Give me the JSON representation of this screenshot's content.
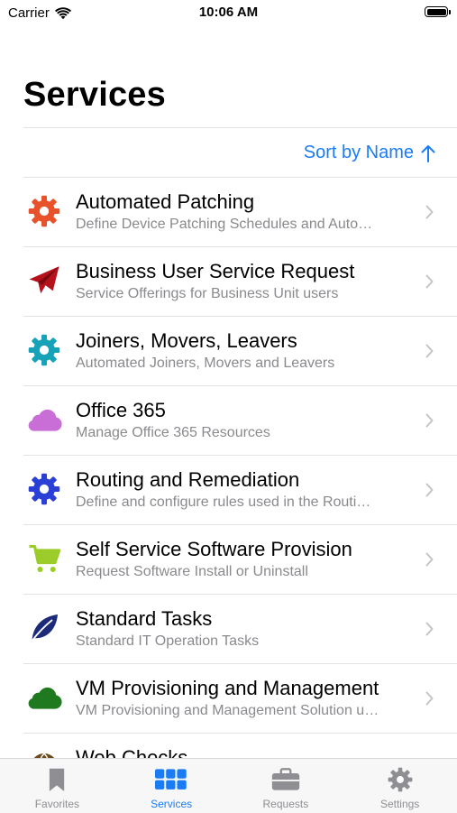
{
  "status_bar": {
    "carrier": "Carrier",
    "time": "10:06 AM"
  },
  "page_title": "Services",
  "sort": {
    "label": "Sort by Name",
    "accent": "#1a7cf5"
  },
  "services": [
    {
      "title": "Automated Patching",
      "subtitle": "Define Device Patching Schedules and Auto…",
      "icon": "gear-icon",
      "color": "#e8522a"
    },
    {
      "title": "Business User Service Request",
      "subtitle": "Service Offerings for Business Unit users",
      "icon": "paper-plane-icon",
      "color": "#b5121b"
    },
    {
      "title": "Joiners, Movers, Leavers",
      "subtitle": "Automated Joiners, Movers and Leavers",
      "icon": "gear-icon",
      "color": "#16a2b8"
    },
    {
      "title": "Office 365",
      "subtitle": "Manage Office 365 Resources",
      "icon": "cloud-icon",
      "color": "#c86ed6"
    },
    {
      "title": "Routing and Remediation",
      "subtitle": "Define and configure rules used in the Routi…",
      "icon": "gear-icon",
      "color": "#2a3fd6"
    },
    {
      "title": "Self Service Software Provision",
      "subtitle": "Request Software Install or Uninstall",
      "icon": "cart-icon",
      "color": "#9ccc2a"
    },
    {
      "title": "Standard Tasks",
      "subtitle": "Standard IT Operation Tasks",
      "icon": "leaf-icon",
      "color": "#1c2a7a"
    },
    {
      "title": "VM Provisioning and Management",
      "subtitle": "VM Provisioning and Management Solution u…",
      "icon": "cloud-icon",
      "color": "#1f7a1f"
    },
    {
      "title": "Web Checks",
      "subtitle": "",
      "icon": "globe-icon",
      "color": "#6b4a1e"
    }
  ],
  "tabs": [
    {
      "label": "Favorites",
      "icon": "bookmark-icon",
      "active": false
    },
    {
      "label": "Services",
      "icon": "grid-icon",
      "active": true
    },
    {
      "label": "Requests",
      "icon": "briefcase-icon",
      "active": false
    },
    {
      "label": "Settings",
      "icon": "gear-icon",
      "active": false
    }
  ],
  "colors": {
    "tab_inactive": "#8e8e93",
    "tab_active": "#1a7cf5"
  }
}
